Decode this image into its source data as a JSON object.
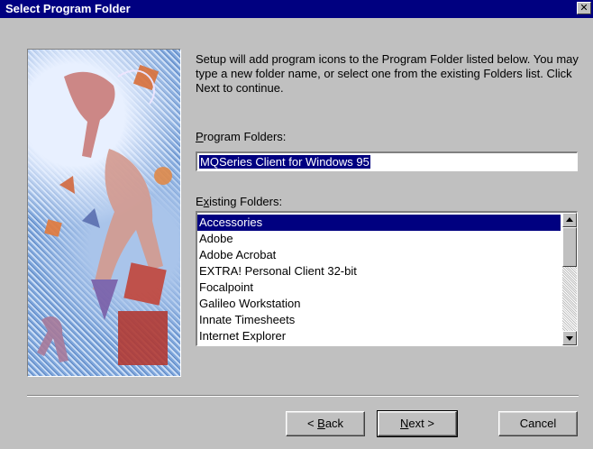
{
  "window": {
    "title": "Select Program Folder",
    "close_glyph": "✕"
  },
  "intro_text": "Setup will add program icons to the Program Folder listed below. You may type a new folder name, or select one from the existing Folders list.  Click Next to continue.",
  "program_folders": {
    "label_accel": "P",
    "label_rest": "rogram Folders:",
    "value": "MQSeries Client for Windows 95"
  },
  "existing_folders": {
    "label_pre": "E",
    "label_accel": "x",
    "label_rest": "isting Folders:",
    "items": [
      "Accessories",
      "Adobe",
      "Adobe Acrobat",
      "EXTRA! Personal Client 32-bit",
      "Focalpoint",
      "Galileo Workstation",
      "Innate Timesheets",
      "Internet Explorer"
    ],
    "selected_index": 0
  },
  "buttons": {
    "back_pre": "< ",
    "back_accel": "B",
    "back_rest": "ack",
    "next_accel": "N",
    "next_rest": "ext >",
    "cancel": "Cancel"
  },
  "icons": {
    "close": "close-icon",
    "scroll_up": "scroll-up-arrow-icon",
    "scroll_down": "scroll-down-arrow-icon"
  },
  "colors": {
    "title_bar": "#000080",
    "dialog_bg": "#c0c0c0",
    "selection": "#000080"
  }
}
